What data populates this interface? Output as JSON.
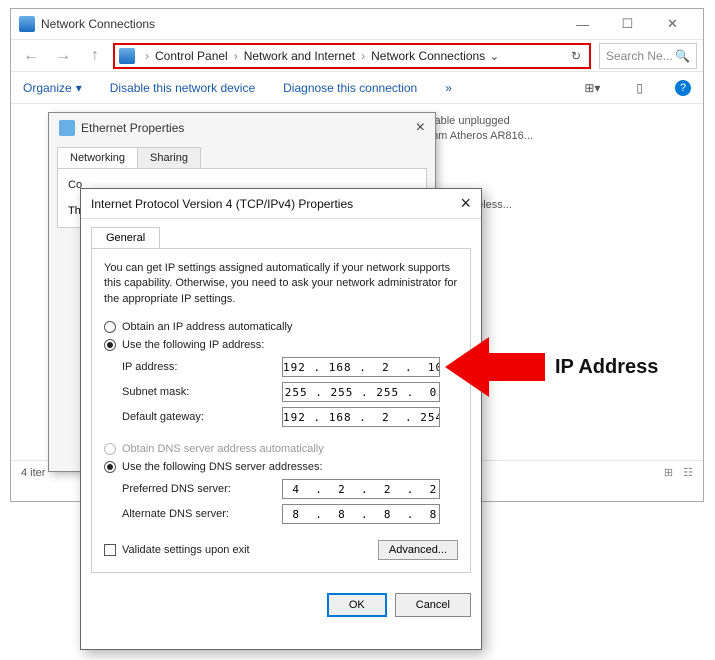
{
  "main_window": {
    "title": "Network Connections",
    "breadcrumb": {
      "b1": "Control Panel",
      "b2": "Network and Internet",
      "b3": "Network Connections"
    },
    "search_placeholder": "Search Ne...",
    "toolbar": {
      "organize": "Organize",
      "disable": "Disable this network device",
      "diagnose": "Diagnose this connection",
      "more": "»"
    },
    "adapter1": {
      "line1": "cable unplugged",
      "line2": "mm Atheros AR816..."
    },
    "adapter2": "ireless...",
    "status": "4 iter"
  },
  "eth_window": {
    "title": "Ethernet Properties",
    "tab1": "Networking",
    "tab2": "Sharing",
    "connect_label": "Co",
    "th_label": "Th"
  },
  "ip_window": {
    "title": "Internet Protocol Version 4 (TCP/IPv4) Properties",
    "tab": "General",
    "desc": "You can get IP settings assigned automatically if your network supports this capability. Otherwise, you need to ask your network administrator for the appropriate IP settings.",
    "radios": {
      "auto_ip": "Obtain an IP address automatically",
      "manual_ip": "Use the following IP address:",
      "auto_dns": "Obtain DNS server address automatically",
      "manual_dns": "Use the following DNS server addresses:"
    },
    "fields": {
      "ip_label": "IP address:",
      "ip_value": "192 . 168 .  2  .  10",
      "subnet_label": "Subnet mask:",
      "subnet_value": "255 . 255 . 255 .  0",
      "gateway_label": "Default gateway:",
      "gateway_value": "192 . 168 .  2  . 254",
      "pdns_label": "Preferred DNS server:",
      "pdns_value": " 4  .  2  .  2  .  2",
      "adns_label": "Alternate DNS server:",
      "adns_value": " 8  .  8  .  8  .  8"
    },
    "validate": "Validate settings upon exit",
    "advanced": "Advanced...",
    "ok": "OK",
    "cancel": "Cancel"
  },
  "annotation": "IP Address"
}
